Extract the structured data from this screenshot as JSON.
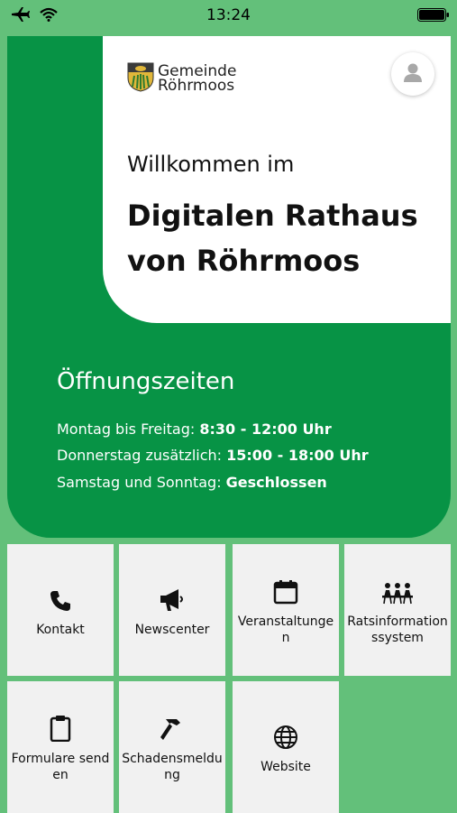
{
  "status": {
    "time": "13:24"
  },
  "logo": {
    "line1": "Gemeinde",
    "line2": "Röhrmoos"
  },
  "welcome": "Willkommen im",
  "headline": {
    "line1": "Digitalen Rathaus",
    "line2": "von Röhrmoos"
  },
  "hours": {
    "title": "Öffnungszeiten",
    "rows": [
      {
        "label": "Montag bis Freitag:",
        "value": "8:30 - 12:00 Uhr"
      },
      {
        "label": "Donnerstag zusätzlich:",
        "value": "15:00 - 18:00 Uhr"
      },
      {
        "label": "Samstag und Sonntag:",
        "value": "Geschlossen"
      }
    ]
  },
  "tiles": [
    {
      "label": "Kontakt",
      "icon": "phone-icon"
    },
    {
      "label": "Newscenter",
      "icon": "megaphone-icon"
    },
    {
      "label": "Veranstaltungen",
      "icon": "calendar-icon"
    },
    {
      "label": "Ratsinformationssystem",
      "icon": "meeting-icon"
    },
    {
      "label": "Formulare senden",
      "icon": "clipboard-icon"
    },
    {
      "label": "Schadensmeldung",
      "icon": "hammer-icon"
    },
    {
      "label": "Website",
      "icon": "globe-icon"
    }
  ],
  "colors": {
    "brand_green": "#079345",
    "background_green": "#63c07a",
    "tile": "#f1f1f1"
  }
}
